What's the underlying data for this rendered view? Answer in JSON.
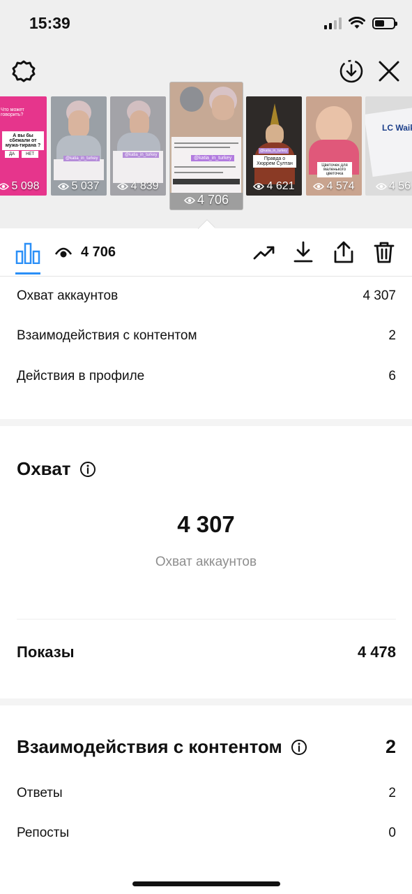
{
  "status_bar": {
    "time": "15:39"
  },
  "stories": [
    {
      "views": "5 098",
      "bg": "#e6358c",
      "texts": [
        "Что может говорить?",
        "А вы бы сбежали от мужа-тирана ?",
        "ДА",
        "НЕТ"
      ]
    },
    {
      "views": "5 037",
      "bg": "#9aa0a6",
      "texts": [
        "@katia_in_turkey"
      ]
    },
    {
      "views": "4 839",
      "bg": "#a3a3a8",
      "texts": [
        "@katia_in_turkey"
      ]
    },
    {
      "views": "4 706",
      "bg": "#c9b29d",
      "texts": [
        "@katia_in_turkey"
      ]
    },
    {
      "views": "4 621",
      "bg": "#2e2a28",
      "texts": [
        "@katia_in_turkey",
        "Правда о Хюррем Султан"
      ]
    },
    {
      "views": "4 574",
      "bg": "#c9a48f",
      "texts": [
        "Цветочек для маленького цветочка"
      ]
    },
    {
      "views": "4 56",
      "bg": "#dcdcdc",
      "texts": [
        "LC Waiki"
      ]
    }
  ],
  "action_bar": {
    "views": "4 706"
  },
  "summary_rows": [
    {
      "label": "Охват аккаунтов",
      "value": "4 307"
    },
    {
      "label": "Взаимодействия с контентом",
      "value": "2"
    },
    {
      "label": "Действия в профиле",
      "value": "6"
    }
  ],
  "reach": {
    "title": "Охват",
    "number": "4 307",
    "caption": "Охват аккаунтов",
    "impressions_label": "Показы",
    "impressions_value": "4 478"
  },
  "interactions": {
    "title": "Взаимодействия с контентом",
    "value": "2",
    "rows": [
      {
        "label": "Ответы",
        "value": "2"
      },
      {
        "label": "Репосты",
        "value": "0"
      }
    ]
  },
  "colors": {
    "accent": "#2a8ff7",
    "muted": "#8e8e8e"
  }
}
